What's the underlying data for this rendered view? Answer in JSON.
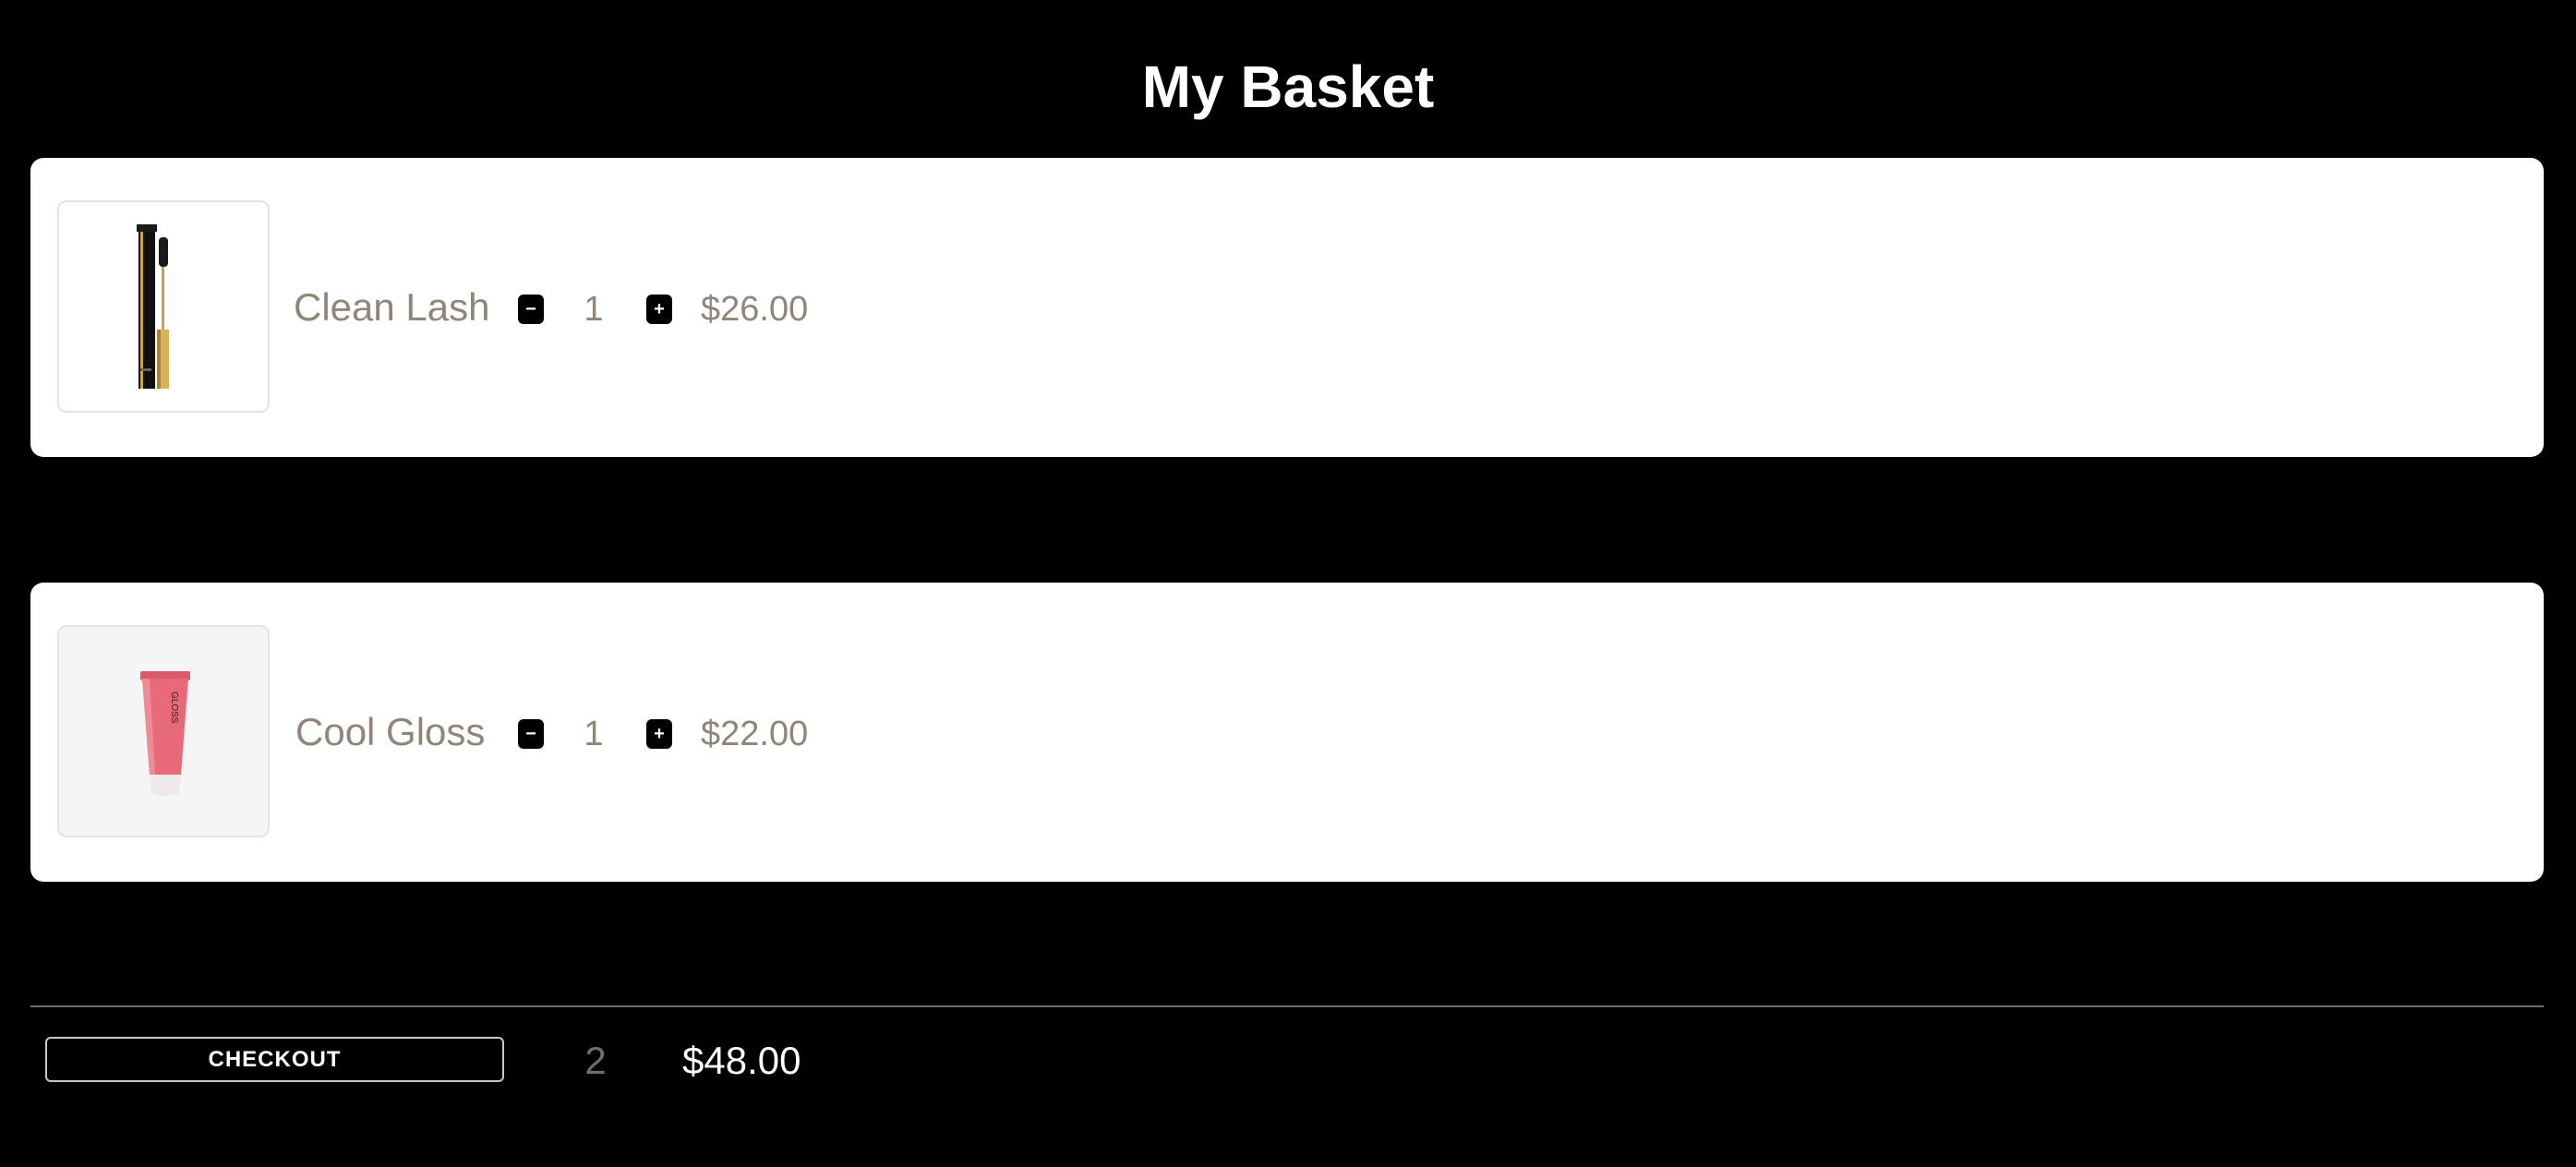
{
  "page": {
    "title": "My Basket"
  },
  "items": [
    {
      "name": "Clean Lash",
      "quantity": "1",
      "price": "$26.00",
      "image_icon": "mascara-icon",
      "minus_icon": "minus-icon",
      "plus_icon": "plus-icon"
    },
    {
      "name": "Cool Gloss",
      "quantity": "1",
      "price": "$22.00",
      "image_icon": "lip-gloss-icon",
      "minus_icon": "minus-icon",
      "plus_icon": "plus-icon"
    }
  ],
  "footer": {
    "checkout_label": "CHECKOUT",
    "total_count": "2",
    "total_price": "$48.00"
  },
  "colors": {
    "background": "#000000",
    "card": "#ffffff",
    "muted_text": "#8f8579",
    "gloss_pink": "#e86a78"
  }
}
